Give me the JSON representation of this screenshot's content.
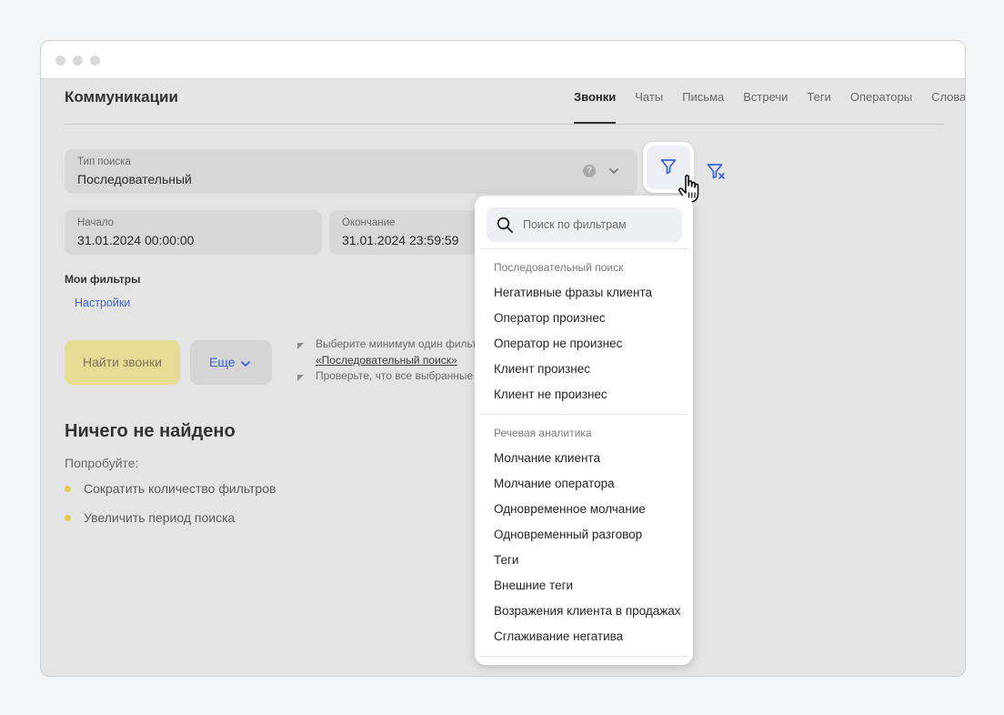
{
  "page": {
    "title": "Коммуникации"
  },
  "tabs": [
    {
      "label": "Звонки",
      "active": true
    },
    {
      "label": "Чаты"
    },
    {
      "label": "Письма"
    },
    {
      "label": "Встречи"
    },
    {
      "label": "Теги"
    },
    {
      "label": "Операторы"
    },
    {
      "label": "Словари"
    }
  ],
  "search_type": {
    "label": "Тип поиска",
    "value": "Последовательный",
    "help": "?"
  },
  "period": {
    "start": {
      "label": "Начало",
      "value": "31.01.2024 00:00:00"
    },
    "end": {
      "label": "Окончание",
      "value": "31.01.2024 23:59:59"
    }
  },
  "my_filters": {
    "title": "Мои фильтры",
    "settings": "Настройки"
  },
  "actions": {
    "find": "Найти звонки",
    "more": "Еще"
  },
  "hints": {
    "line1": "Выберите минимум один фильтр",
    "line1_link": "«Последовательный поиск»",
    "line2": "Проверьте, что все выбранные ф"
  },
  "empty": {
    "title": "Ничего не найдено",
    "subtitle": "Попробуйте:",
    "tips": [
      "Сократить количество фильтров",
      "Увеличить период поиска"
    ]
  },
  "dropdown": {
    "search_placeholder": "Поиск по фильтрам",
    "groups": [
      {
        "title": "Последовательный поиск",
        "items": [
          "Негативные фразы клиента",
          "Оператор произнес",
          "Оператор не произнес",
          "Клиент произнес",
          "Клиент не произнес"
        ]
      },
      {
        "title": "Речевая аналитика",
        "items": [
          "Молчание клиента",
          "Молчание оператора",
          "Одновременное молчание",
          "Одновременный разговор",
          "Теги",
          "Внешние теги",
          "Возражения клиента в продажах",
          "Сглаживание негатива"
        ]
      }
    ]
  },
  "colors": {
    "accent": "#3b62d6",
    "find_button": "#e7dc95",
    "bullet": "#e7c94a"
  },
  "icons": [
    "filter-icon",
    "filter-clear-icon",
    "hand-cursor-icon",
    "search-icon",
    "chevron-down-icon",
    "help-icon"
  ]
}
